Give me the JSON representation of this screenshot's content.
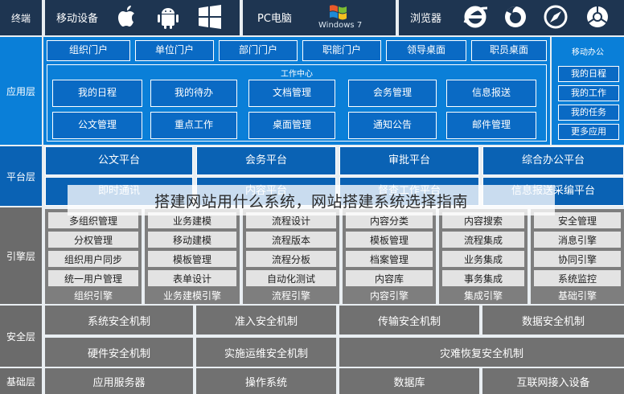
{
  "rows": {
    "terminal": "终端",
    "application": "应用层",
    "platform": "平台层",
    "engine": "引擎层",
    "security": "安全层",
    "base": "基础层"
  },
  "terminal": {
    "mobile_label": "移动设备",
    "pc_label": "PC电脑",
    "windows_text": "Windows 7",
    "browser_label": "浏览器",
    "icons": [
      "apple-icon",
      "android-icon",
      "windows-icon",
      "ie-icon",
      "firefox-icon",
      "safari-icon",
      "chrome-icon"
    ]
  },
  "portals": [
    "组织门户",
    "单位门户",
    "部门门户",
    "职能门户",
    "领导桌面",
    "职员桌面"
  ],
  "work_center": {
    "title": "工作中心",
    "items": [
      "我的日程",
      "我的待办",
      "文档管理",
      "会务管理",
      "信息报送",
      "公文管理",
      "重点工作",
      "桌面管理",
      "通知公告",
      "邮件管理"
    ]
  },
  "mobile_office": {
    "title": "移动办公",
    "items": [
      "我的日程",
      "我的工作",
      "我的任务",
      "更多应用"
    ]
  },
  "platform": {
    "top": [
      "公文平台",
      "会务平台",
      "审批平台",
      "综合办公平台"
    ],
    "bottom": [
      "即时通讯",
      "内容平台",
      "督查工作平台",
      "信息报送采编平台"
    ]
  },
  "engine": {
    "columns": [
      {
        "items": [
          "多组织管理",
          "分权管理",
          "组织用户同步",
          "统一用户管理"
        ],
        "footer": "组织引擎"
      },
      {
        "items": [
          "业务建模",
          "移动建模",
          "模板管理",
          "表单设计"
        ],
        "footer": "业务建模引擎"
      },
      {
        "items": [
          "流程设计",
          "流程版本",
          "流程分板",
          "自动化测试"
        ],
        "footer": "流程引擎"
      },
      {
        "items": [
          "内容分类",
          "模板管理",
          "档案管理",
          "内容库"
        ],
        "footer": "内容引擎"
      },
      {
        "items": [
          "内容搜索",
          "流程集成",
          "业务集成",
          "事务集成"
        ],
        "footer": "集成引擎"
      },
      {
        "items": [
          "安全管理",
          "消息引擎",
          "协同引擎",
          "系统监控"
        ],
        "footer": "基础引擎"
      }
    ]
  },
  "security": {
    "row1": [
      "系统安全机制",
      "准入安全机制",
      "传输安全机制",
      "数据安全机制"
    ],
    "row2": [
      "硬件安全机制",
      "实施运维安全机制",
      "灾难恢复安全机制"
    ]
  },
  "base": [
    "应用服务器",
    "操作系统",
    "数据库",
    "互联网接入设备"
  ],
  "watermark": "搭建网站用什么系统，网站搭建系统选择指南",
  "colors": {
    "dark": "#1e3551",
    "blue": "#0a7fd8",
    "deep": "#0a62b4",
    "grey": "#6b6b6b",
    "light_item": "#e3e3e3"
  }
}
